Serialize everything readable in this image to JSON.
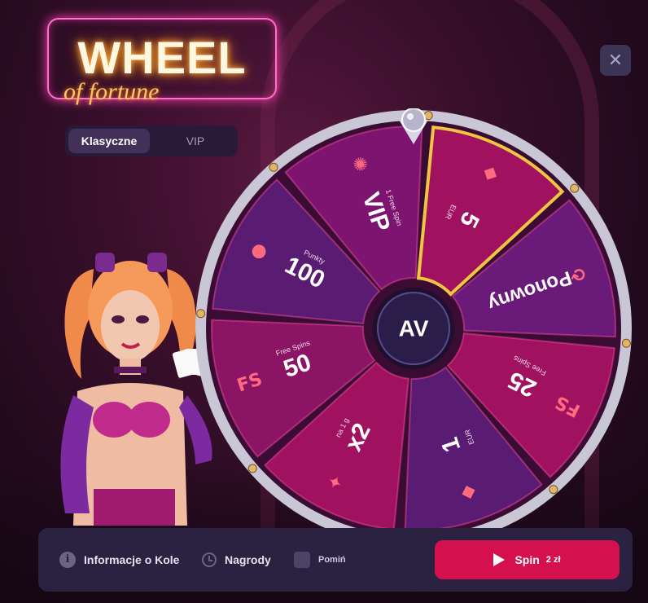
{
  "logo": {
    "title": "WHEEL",
    "subtitle": "of fortune"
  },
  "tabs": [
    {
      "label": "Klasyczne",
      "active": true
    },
    {
      "label": "VIP",
      "active": false
    }
  ],
  "close_icon": "close-icon",
  "wheel": {
    "center_logo": "AV",
    "segments": [
      {
        "main": "5",
        "sub": "EUR",
        "icon": "gems-icon",
        "color": "#a0115f"
      },
      {
        "main": "Ponowny",
        "sub": "",
        "icon": "refresh-icon",
        "color": "#6a1a78"
      },
      {
        "main": "25",
        "sub": "Free Spins",
        "icon": "fs-icon",
        "color": "#a0115f"
      },
      {
        "main": "1",
        "sub": "EUR",
        "icon": "gems-icon",
        "color": "#5a1c72"
      },
      {
        "main": "x2",
        "sub": "na 1 g",
        "icon": "star-icon",
        "color": "#a0115f"
      },
      {
        "main": "50",
        "sub": "Free Spins",
        "icon": "fs-icon",
        "color": "#8b1465"
      },
      {
        "main": "100",
        "sub": "Punkty",
        "icon": "coin-icon",
        "color": "#5a1c72"
      },
      {
        "main": "VIP",
        "sub": "1 Free Spin",
        "icon": "vip-wheel-icon",
        "color": "#7d1470"
      }
    ]
  },
  "bar": {
    "info_label": "Informacje o Kole",
    "prizes_label": "Nagrody",
    "skip_label": "Pomiń",
    "spin_label": "Spin",
    "spin_amount": "2 zł"
  },
  "colors": {
    "accent": "#d4104f",
    "highlight": "#f0c541"
  }
}
